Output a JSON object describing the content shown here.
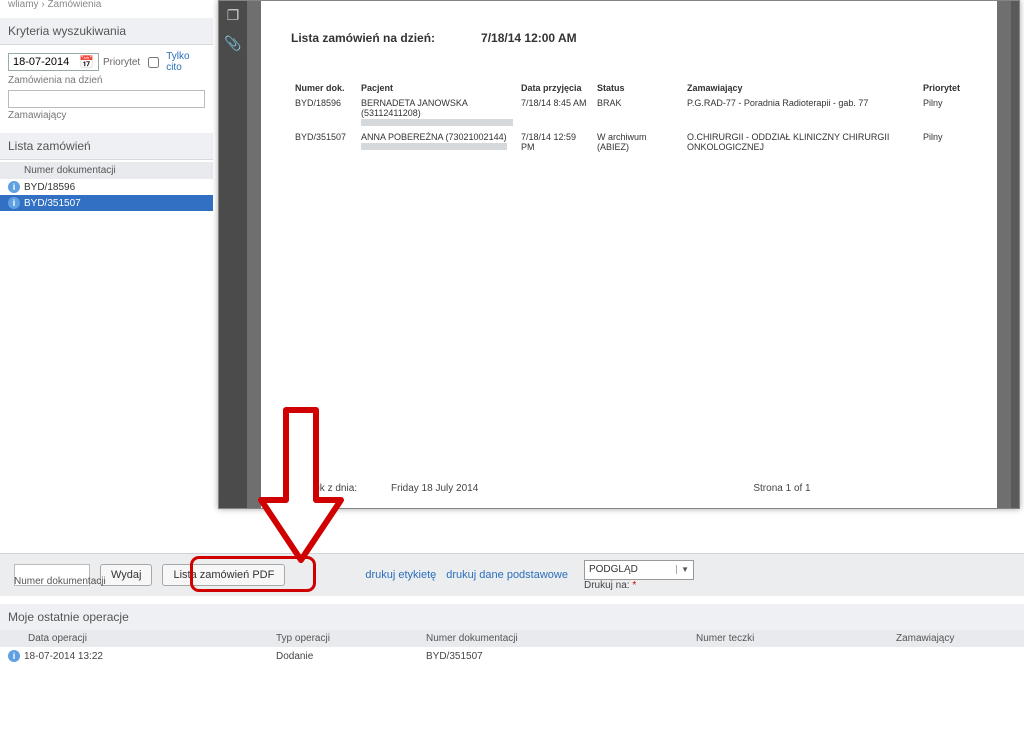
{
  "breadcrumb": "wliamy  ›  Zamówienia",
  "search": {
    "panel_title": "Kryteria wyszukiwania",
    "date_value": "18-07-2014",
    "date_hint": "Zamówienia na dzień",
    "priority_label": "Priorytet",
    "only_cito_label": "Tylko cito",
    "req_field_hint": "Zamawiający"
  },
  "orders_panel": {
    "title": "Lista zamówień",
    "column": "Numer dokumentacji",
    "rows": [
      {
        "id": "BYD/18596",
        "selected": false
      },
      {
        "id": "BYD/351507",
        "selected": true
      }
    ]
  },
  "pdf": {
    "title_label": "Lista zamówień na dzień:",
    "title_value": "7/18/14 12:00 AM",
    "cols": {
      "doc": "Numer dok.",
      "patient": "Pacjent",
      "admit": "Data przyjęcia",
      "status": "Status",
      "requester": "Zamawiający",
      "priority": "Priorytet"
    },
    "rows": [
      {
        "doc": "BYD/18596",
        "patient": "BERNADETA JANOWSKA (53112411208)",
        "admit": "7/18/14 8:45 AM",
        "status": "BRAK",
        "requester": "P.G.RAD-77 - Poradnia Radioterapii - gab. 77",
        "priority": "Pilny"
      },
      {
        "doc": "BYD/351507",
        "patient": "ANNA POBEREŻNA (73021002144)",
        "admit": "7/18/14 12:59 PM",
        "status": "W archiwum (ABIEZ)",
        "requester": "O.CHIRURGII - ODDZIAŁ KLINICZNY CHIRURGII ONKOLOGICZNEJ",
        "priority": "Pilny"
      }
    ],
    "footer_label": "Wydruk z dnia:",
    "footer_date": "Friday 18 July 2014",
    "footer_page": "Strona 1 of 1"
  },
  "actions": {
    "issue_btn": "Wydaj",
    "pdf_btn": "Lista zamówień PDF",
    "print_label_link": "drukuj etykietę",
    "print_basic_link": "drukuj dane podstawowe",
    "printer_select": "PODGLĄD",
    "printer_hint": "Drukuj na: ",
    "doc_num_hint": "Numer dokumentacji"
  },
  "ops": {
    "title": "Moje ostatnie operacje",
    "cols": {
      "date": "Data operacji",
      "type": "Typ operacji",
      "doc": "Numer dokumentacji",
      "folder": "Numer teczki",
      "requester": "Zamawiający"
    },
    "rows": [
      {
        "date": "18-07-2014 13:22",
        "type": "Dodanie",
        "doc": "BYD/351507",
        "folder": "",
        "requester": ""
      }
    ]
  }
}
